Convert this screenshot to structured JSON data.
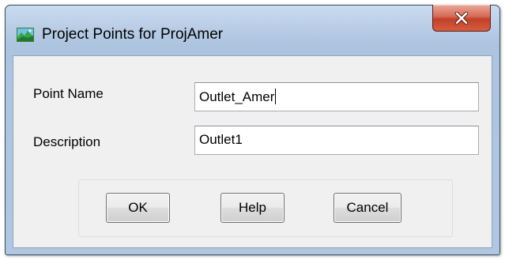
{
  "window": {
    "title": "Project Points for ProjAmer",
    "icon": "landscape-app-icon",
    "close_icon": "close-x-icon"
  },
  "form": {
    "point_name": {
      "label": "Point Name",
      "value": "Outlet_Amer"
    },
    "description": {
      "label": "Description",
      "value": "Outlet1"
    }
  },
  "buttons": {
    "ok": "OK",
    "help": "Help",
    "cancel": "Cancel"
  },
  "colors": {
    "title_bar": "#b8cde5",
    "close_button": "#c2402a",
    "client_background": "#f0f0f0"
  }
}
